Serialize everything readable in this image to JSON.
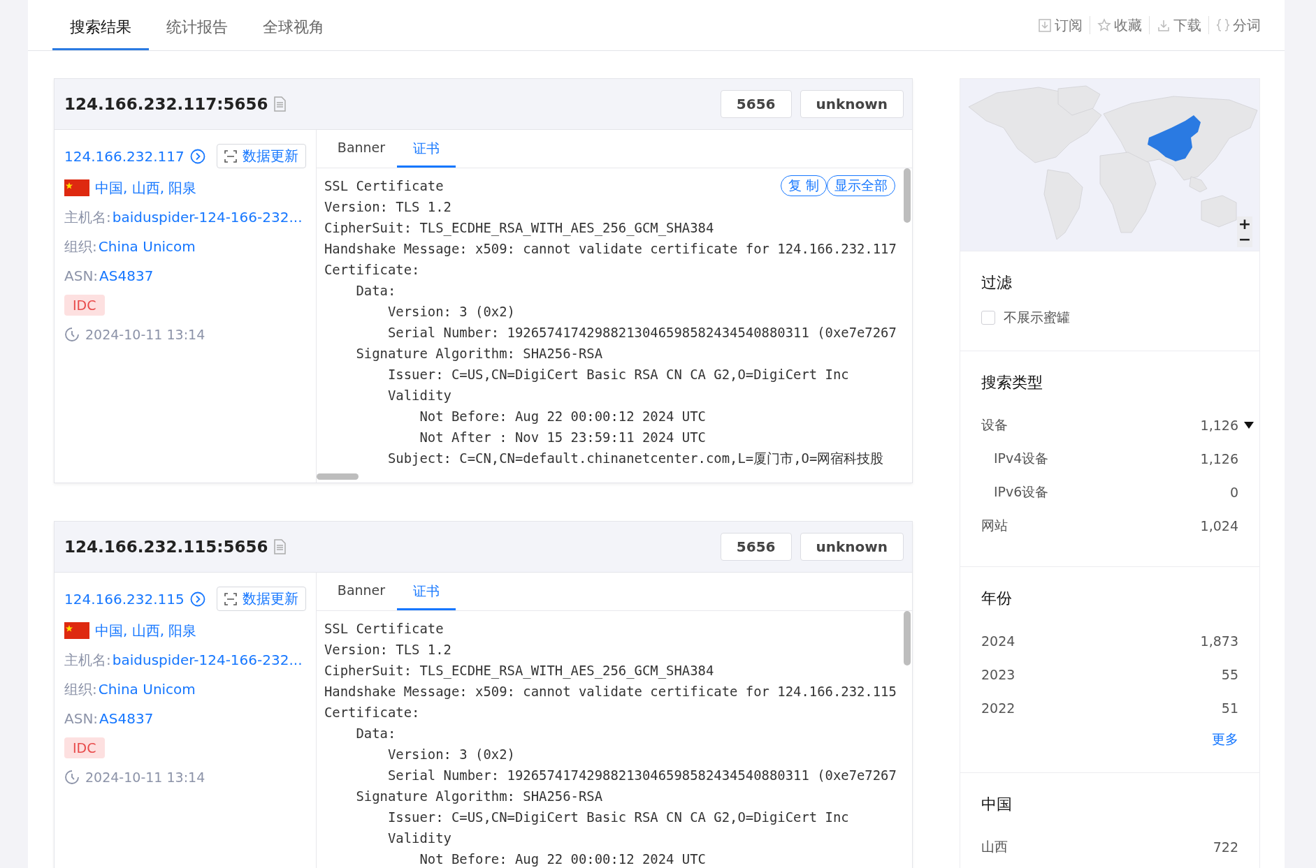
{
  "tabs": [
    {
      "label": "搜索结果",
      "selected": true
    },
    {
      "label": "统计报告",
      "selected": false
    },
    {
      "label": "全球视角",
      "selected": false
    }
  ],
  "toolbar": [
    {
      "kind": "subscribe",
      "label": "订阅"
    },
    {
      "kind": "star",
      "label": "收藏"
    },
    {
      "kind": "download",
      "label": "下载"
    },
    {
      "kind": "braces",
      "label": "分词"
    }
  ],
  "results": [
    {
      "address": "124.166.232.117:5656",
      "chips": [
        "5656",
        "unknown"
      ],
      "ip": "124.166.232.117",
      "update_button": "数据更新",
      "location": "中国, 山西, 阳泉",
      "fields": [
        {
          "label": "主机名:",
          "value": "baiduspider-124-166-232..."
        },
        {
          "label": "组织:",
          "value": "China Unicom"
        },
        {
          "label": "ASN:",
          "value": "AS4837"
        }
      ],
      "tag": "IDC",
      "time": "2024-10-11 13:14",
      "panel_tabs": [
        {
          "label": "Banner",
          "selected": false
        },
        {
          "label": "证书",
          "selected": true
        }
      ],
      "actions": [
        "复 制",
        "显示全部"
      ],
      "lines": [
        {
          "text": "SSL Certificate"
        },
        {
          "text": "Version: TLS 1.2"
        },
        {
          "text": "CipherSuit: TLS_ECDHE_RSA_WITH_AES_256_GCM_SHA384"
        },
        {
          "text": "Handshake Message: x509: cannot validate certificate for 124.166.232.117"
        },
        {
          "text": "Certificate:",
          "children": [
            {
              "text": "Data:",
              "children": [
                {
                  "text": "Version: 3 (0x2)"
                },
                {
                  "text": "Serial Number: 19265741742988213046598582434540880311 (0xe7e7267"
                }
              ]
            },
            {
              "text": "Signature Algorithm: SHA256-RSA",
              "children": [
                {
                  "text": "Issuer: C=US,CN=DigiCert Basic RSA CN CA G2,O=DigiCert Inc"
                },
                {
                  "text": "Validity",
                  "children": [
                    {
                      "text": "Not Before: Aug 22 00:00:12 2024 UTC"
                    },
                    {
                      "text": "Not After : Nov 15 23:59:11 2024 UTC"
                    }
                  ]
                },
                {
                  "text": "Subject: C=CN,CN=default.chinanetcenter.com,L=厦门市,O=网宿科技股"
                }
              ]
            }
          ]
        }
      ]
    },
    {
      "address": "124.166.232.115:5656",
      "chips": [
        "5656",
        "unknown"
      ],
      "ip": "124.166.232.115",
      "update_button": "数据更新",
      "location": "中国, 山西, 阳泉",
      "fields": [
        {
          "label": "主机名:",
          "value": "baiduspider-124-166-232..."
        },
        {
          "label": "组织:",
          "value": "China Unicom"
        },
        {
          "label": "ASN:",
          "value": "AS4837"
        }
      ],
      "tag": "IDC",
      "time": "2024-10-11 13:14",
      "panel_tabs": [
        {
          "label": "Banner",
          "selected": false
        },
        {
          "label": "证书",
          "selected": true
        }
      ],
      "lines": [
        {
          "text": "SSL Certificate"
        },
        {
          "text": "Version: TLS 1.2"
        },
        {
          "text": "CipherSuit: TLS_ECDHE_RSA_WITH_AES_256_GCM_SHA384"
        },
        {
          "text": "Handshake Message: x509: cannot validate certificate for 124.166.232.115"
        },
        {
          "text": "Certificate:",
          "children": [
            {
              "text": "Data:",
              "children": [
                {
                  "text": "Version: 3 (0x2)"
                },
                {
                  "text": "Serial Number: 19265741742988213046598582434540880311 (0xe7e7267"
                }
              ]
            },
            {
              "text": "Signature Algorithm: SHA256-RSA",
              "children": [
                {
                  "text": "Issuer: C=US,CN=DigiCert Basic RSA CN CA G2,O=DigiCert Inc"
                },
                {
                  "text": "Validity",
                  "children": [
                    {
                      "text": "Not Before: Aug 22 00:00:12 2024 UTC"
                    }
                  ]
                }
              ]
            }
          ]
        }
      ]
    }
  ],
  "sidebar": {
    "map": {
      "zoom_buttons": [
        "+",
        "−"
      ]
    },
    "filter": {
      "title": "过滤",
      "options": [
        {
          "label": "不展示蜜罐",
          "checked": false
        }
      ]
    },
    "search_type": {
      "title": "搜索类型",
      "rows": [
        {
          "label": "设备",
          "count": "1,126",
          "expanded": true,
          "children": [
            {
              "label": "IPv4设备",
              "count": "1,126"
            },
            {
              "label": "IPv6设备",
              "count": "0"
            }
          ]
        },
        {
          "label": "网站",
          "count": "1,024"
        }
      ]
    },
    "years": {
      "title": "年份",
      "rows": [
        {
          "label": "2024",
          "count": "1,873"
        },
        {
          "label": "2023",
          "count": "55"
        },
        {
          "label": "2022",
          "count": "51"
        }
      ],
      "more": "更多"
    },
    "region": {
      "title": "中国",
      "rows": [
        {
          "label": "山西",
          "count": "722"
        }
      ]
    }
  }
}
